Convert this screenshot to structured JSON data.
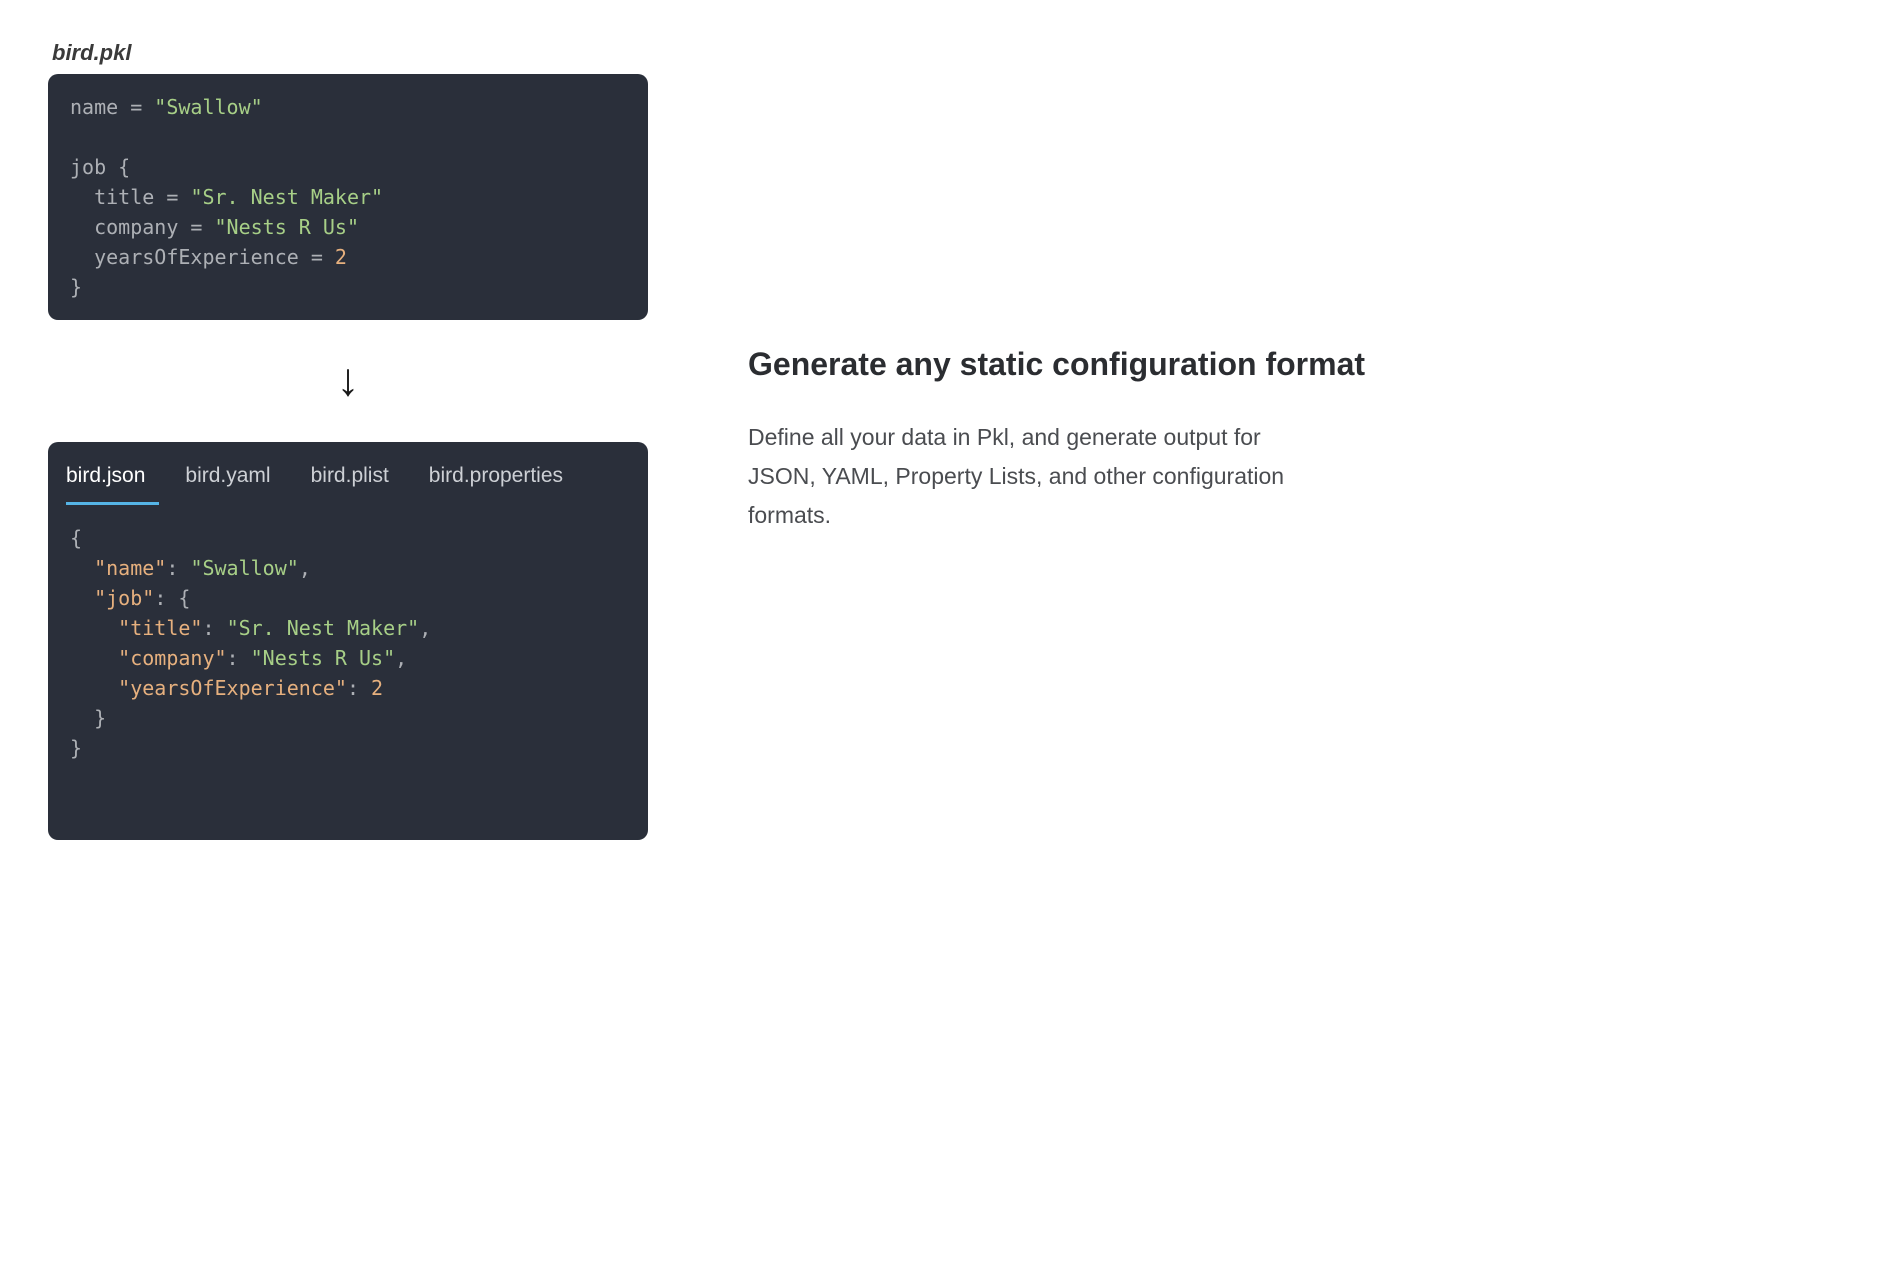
{
  "source_file": {
    "filename": "bird.pkl",
    "code": {
      "line1_ident": "name",
      "line1_eq": " = ",
      "line1_val": "\"Swallow\"",
      "blank": "",
      "line2_ident": "job",
      "line2_brace": " {",
      "line3_indent": "  ",
      "line3_ident": "title",
      "line3_eq": " = ",
      "line3_val": "\"Sr. Nest Maker\"",
      "line4_indent": "  ",
      "line4_ident": "company",
      "line4_eq": " = ",
      "line4_val": "\"Nests R Us\"",
      "line5_indent": "  ",
      "line5_ident": "yearsOfExperience",
      "line5_eq": " = ",
      "line5_val": "2",
      "line6_brace": "}"
    }
  },
  "output_tabs": [
    {
      "label": "bird.json",
      "active": true
    },
    {
      "label": "bird.yaml",
      "active": false
    },
    {
      "label": "bird.plist",
      "active": false
    },
    {
      "label": "bird.properties",
      "active": false
    }
  ],
  "output_code": {
    "l1": "{",
    "l2_indent": "  ",
    "l2_key": "\"name\"",
    "l2_colon": ": ",
    "l2_val": "\"Swallow\"",
    "l2_comma": ",",
    "l3_indent": "  ",
    "l3_key": "\"job\"",
    "l3_colon": ": ",
    "l3_brace": "{",
    "l4_indent": "    ",
    "l4_key": "\"title\"",
    "l4_colon": ": ",
    "l4_val": "\"Sr. Nest Maker\"",
    "l4_comma": ",",
    "l5_indent": "    ",
    "l5_key": "\"company\"",
    "l5_colon": ": ",
    "l5_val": "\"Nests R Us\"",
    "l5_comma": ",",
    "l6_indent": "    ",
    "l6_key": "\"yearsOfExperience\"",
    "l6_colon": ": ",
    "l6_val": "2",
    "l7_indent": "  ",
    "l7_brace": "}",
    "l8": "}"
  },
  "feature": {
    "heading": "Generate any static configuration format",
    "description": "Define all your data in Pkl, and generate output for JSON, YAML, Property Lists, and other configura­tion formats."
  },
  "arrow_glyph": "↓"
}
